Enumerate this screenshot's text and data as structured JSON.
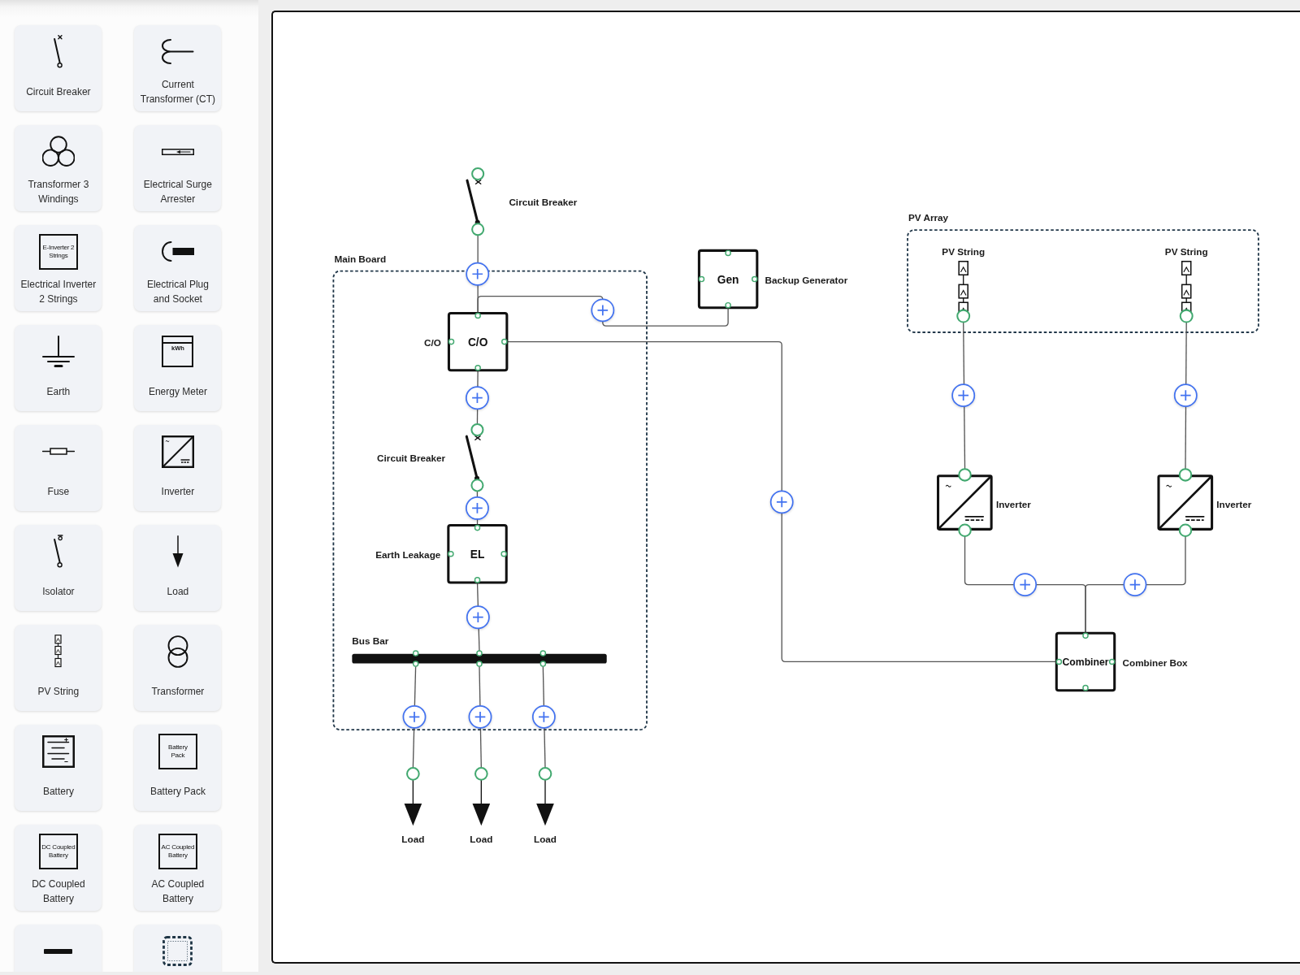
{
  "sidebar": {
    "palette_rows": [
      [
        {
          "kind": "circuit-breaker",
          "label": "Circuit Breaker"
        },
        {
          "kind": "current-transformer",
          "label": "Current Transformer (CT)"
        }
      ],
      [
        {
          "kind": "transformer-3w",
          "label": "Transformer 3 Windings"
        },
        {
          "kind": "surge-arrester",
          "label": "Electrical Surge Arrester"
        }
      ],
      [
        {
          "kind": "text-symbol",
          "label": "Electrical Inverter 2 Strings",
          "symbol_lines": [
            "E-Inverter 2",
            "Strings"
          ]
        },
        {
          "kind": "plug-socket",
          "label": "Electrical Plug and Socket"
        }
      ],
      [
        {
          "kind": "earth",
          "label": "Earth"
        },
        {
          "kind": "meter",
          "label": "Energy Meter",
          "symbol_lines": [
            "kWh"
          ]
        }
      ],
      [
        {
          "kind": "fuse",
          "label": "Fuse"
        },
        {
          "kind": "inverter",
          "label": "Inverter"
        }
      ],
      [
        {
          "kind": "isolator",
          "label": "Isolator"
        },
        {
          "kind": "load",
          "label": "Load"
        }
      ],
      [
        {
          "kind": "pv-string",
          "label": "PV String"
        },
        {
          "kind": "transformer",
          "label": "Transformer"
        }
      ],
      [
        {
          "kind": "battery",
          "label": "Battery"
        },
        {
          "kind": "text-symbol",
          "label": "Battery Pack",
          "symbol_lines": [
            "Battery",
            "Pack"
          ]
        }
      ],
      [
        {
          "kind": "text-symbol",
          "label": "DC Coupled Battery",
          "symbol_lines": [
            "DC Coupled",
            "Battery"
          ]
        },
        {
          "kind": "text-symbol",
          "label": "AC Coupled Battery",
          "symbol_lines": [
            "AC Coupled",
            "Battery"
          ]
        }
      ],
      [
        {
          "kind": "bus-bar"
        },
        {
          "kind": "group"
        }
      ]
    ]
  },
  "canvas": {
    "groups": [
      {
        "label": "Main Board"
      },
      {
        "label": "PV Array"
      }
    ],
    "nodes": [
      {
        "kind": "circuit-breaker",
        "label": "Circuit Breaker"
      },
      {
        "kind": "box",
        "symbol": "C/O",
        "label": "C/O"
      },
      {
        "kind": "circuit-breaker",
        "label": "Circuit Breaker"
      },
      {
        "kind": "box",
        "symbol": "EL",
        "label": "Earth Leakage"
      },
      {
        "kind": "bus-bar",
        "label": "Bus Bar"
      },
      {
        "kind": "load",
        "label": "Load"
      },
      {
        "kind": "load",
        "label": "Load"
      },
      {
        "kind": "load",
        "label": "Load"
      },
      {
        "kind": "box",
        "symbol": "Gen",
        "label": "Backup Generator"
      },
      {
        "kind": "pv-string",
        "label": "PV String"
      },
      {
        "kind": "pv-string",
        "label": "PV String"
      },
      {
        "kind": "inverter",
        "label": "Inverter"
      },
      {
        "kind": "inverter",
        "label": "Inverter"
      },
      {
        "kind": "box",
        "symbol": "Combiner",
        "label": "Combiner Box"
      }
    ]
  }
}
